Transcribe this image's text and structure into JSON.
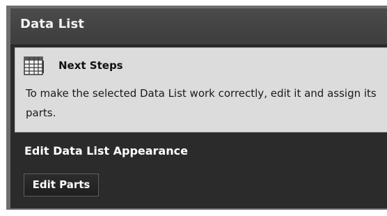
{
  "panel": {
    "title": "Data List"
  },
  "next_steps": {
    "icon": "table-grid-icon",
    "heading": "Next Steps",
    "message": "To make the selected Data List work correctly, edit it and assign its parts."
  },
  "appearance": {
    "heading": "Edit Data List Appearance",
    "button_label": "Edit Parts"
  },
  "colors": {
    "header_bg": "#444444",
    "body_bg": "#2b2b2b",
    "info_bg": "#dcdcdc"
  }
}
